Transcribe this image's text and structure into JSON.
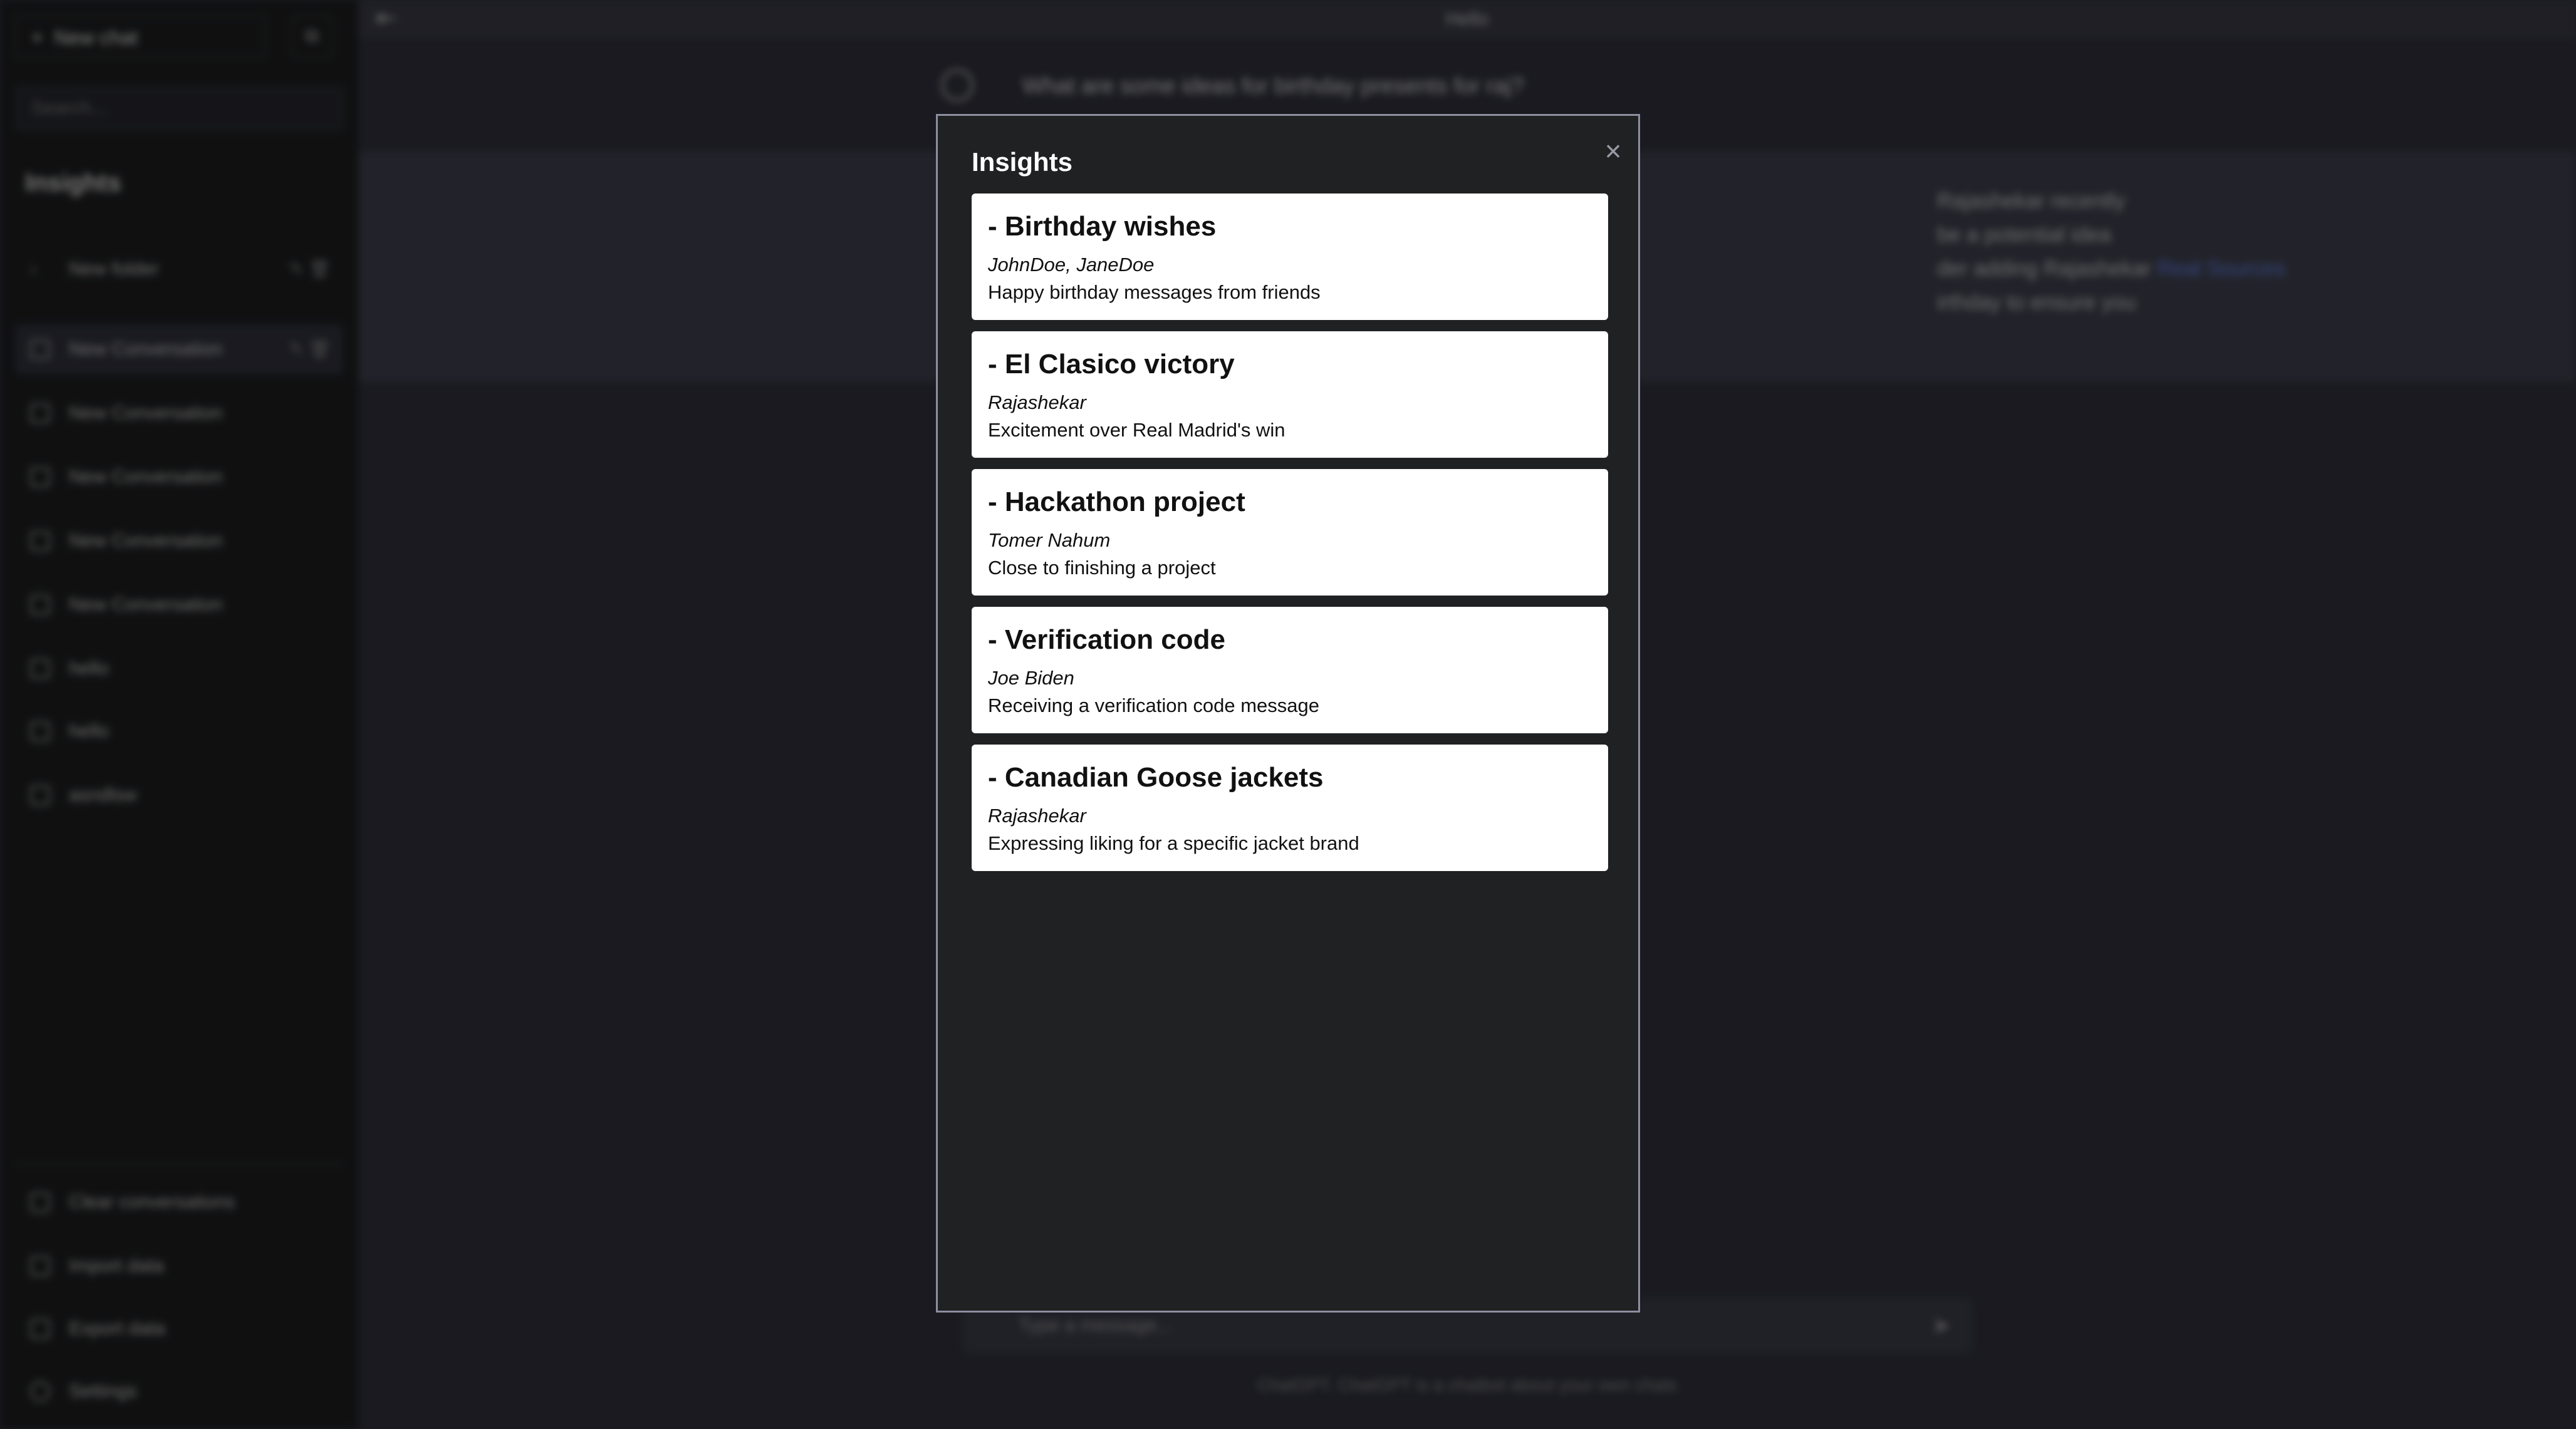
{
  "background": {
    "sidebar": {
      "new_chat": "New chat",
      "search_placeholder": "Search...",
      "heading": "Insights",
      "items": [
        {
          "label": "New folder"
        },
        {
          "label": "New Conversation"
        },
        {
          "label": "New Conversation"
        },
        {
          "label": "New Conversation"
        },
        {
          "label": "New Conversation"
        },
        {
          "label": "New Conversation"
        },
        {
          "label": "hello"
        },
        {
          "label": "hello"
        },
        {
          "label": "asndlsw"
        }
      ],
      "bottom": [
        {
          "label": "Clear conversations"
        },
        {
          "label": "Import data"
        },
        {
          "label": "Export data"
        },
        {
          "label": "Settings"
        }
      ]
    },
    "header_title": "Hello",
    "user_message": "What are some ideas for birthday presents for raj?",
    "bot_message": {
      "line1": "Rajashekar recently",
      "line2": "be a potential idea",
      "line3_pre": "der adding Rajashekar",
      "line3_link": "Real Sources",
      "line4": "irthday to ensure you"
    },
    "input_placeholder": "Type a message...",
    "footer": "ChatGPT. ChatGPT is a chatbot about your own chats"
  },
  "modal": {
    "title": "Insights",
    "close": "×",
    "items": [
      {
        "title": "- Birthday wishes",
        "people": "JohnDoe, JaneDoe",
        "description": "Happy birthday messages from friends"
      },
      {
        "title": "- El Clasico victory",
        "people": "Rajashekar",
        "description": "Excitement over Real Madrid's win"
      },
      {
        "title": "- Hackathon project",
        "people": "Tomer Nahum",
        "description": "Close to finishing a project"
      },
      {
        "title": "- Verification code",
        "people": "Joe Biden",
        "description": "Receiving a verification code message"
      },
      {
        "title": "- Canadian Goose jackets",
        "people": "Rajashekar",
        "description": "Expressing liking for a specific jacket brand"
      }
    ]
  }
}
